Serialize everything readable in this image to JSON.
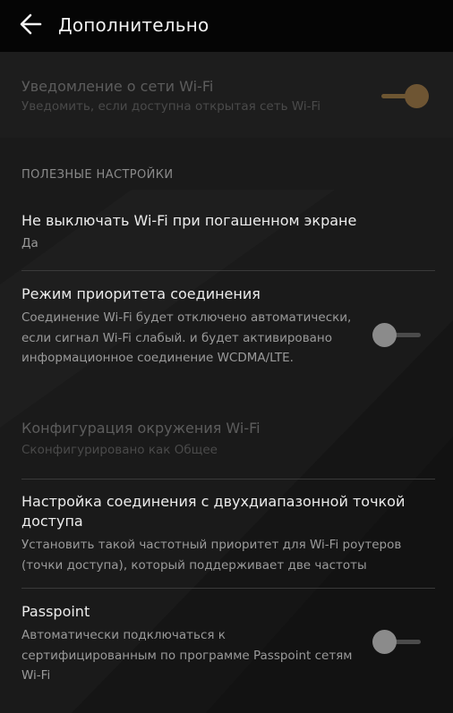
{
  "appbar": {
    "title": "Дополнительно",
    "back_icon": "arrow-left-icon"
  },
  "colors": {
    "appbar_bg": "#050505",
    "screen_bg": "#1a1a1a",
    "accent_dim": "#6e5533",
    "switch_off": "#8b8b8b"
  },
  "wifi_notification": {
    "title": "Уведомление о сети Wi-Fi",
    "summary": "Уведомить, если доступна открытая сеть Wi-Fi",
    "enabled": true,
    "disabled_state": true
  },
  "section": {
    "header": "ПОЛЕЗНЫЕ НАСТРОЙКИ"
  },
  "items": [
    {
      "title": "Не выключать Wi-Fi при погашенном экране",
      "summary": "Да"
    },
    {
      "title": "Режим приоритета соединения",
      "summary": "Соединение Wi-Fi будет отключено автоматически, если сигнал Wi-Fi слабый. и будет активировано информационное соединение WCDMA/LTE.",
      "switch": false
    },
    {
      "title": "Конфигурация окружения Wi-Fi",
      "summary": "Сконфигурировано как Общее",
      "disabled_state": true
    },
    {
      "title": "Настройка соединения с двухдиапазонной точкой доступа",
      "summary": "Установить такой частотный приоритет для Wi-Fi роутеров (точки доступа), который поддерживает две частоты"
    },
    {
      "title": "Passpoint",
      "summary": "Автоматически подключаться к сертифицированным по программе Passpoint сетям Wi-Fi",
      "switch": false
    }
  ]
}
